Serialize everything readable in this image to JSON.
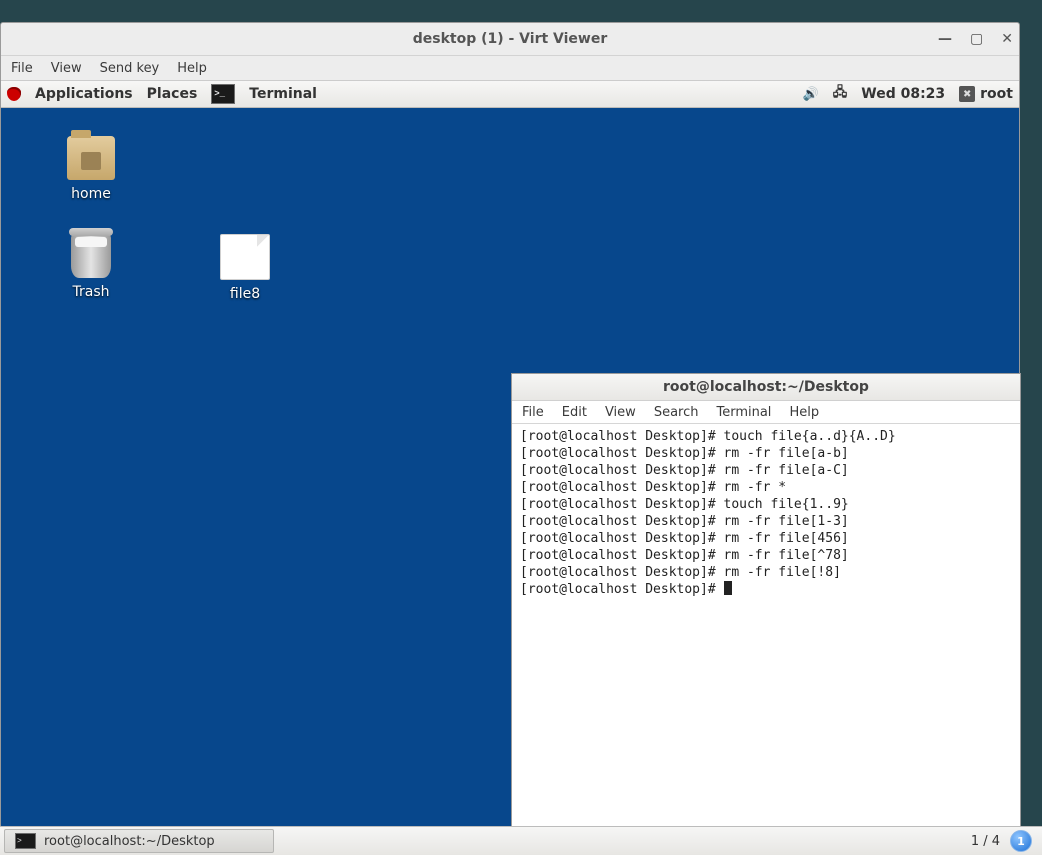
{
  "virt_window": {
    "title": "desktop (1) - Virt Viewer",
    "menu": [
      "File",
      "View",
      "Send key",
      "Help"
    ]
  },
  "gnome_panel": {
    "applications": "Applications",
    "places": "Places",
    "app_running": "Terminal",
    "clock": "Wed 08:23",
    "user": "root"
  },
  "desktop_icons": {
    "home": "home",
    "trash": "Trash",
    "file": "file8"
  },
  "terminal": {
    "title": "root@localhost:~/Desktop",
    "menu": [
      "File",
      "Edit",
      "View",
      "Search",
      "Terminal",
      "Help"
    ],
    "lines": [
      "[root@localhost Desktop]# touch file{a..d}{A..D}",
      "[root@localhost Desktop]# rm -fr file[a-b]",
      "[root@localhost Desktop]# rm -fr file[a-C]",
      "[root@localhost Desktop]# rm -fr *",
      "[root@localhost Desktop]# touch file{1..9}",
      "[root@localhost Desktop]# rm -fr file[1-3]",
      "[root@localhost Desktop]# rm -fr file[456]",
      "[root@localhost Desktop]# rm -fr file[^78]",
      "[root@localhost Desktop]# rm -fr file[!8]",
      "[root@localhost Desktop]# "
    ]
  },
  "taskbar": {
    "task_label": "root@localhost:~/Desktop",
    "pager": "1 / 4",
    "workspace": "1"
  }
}
